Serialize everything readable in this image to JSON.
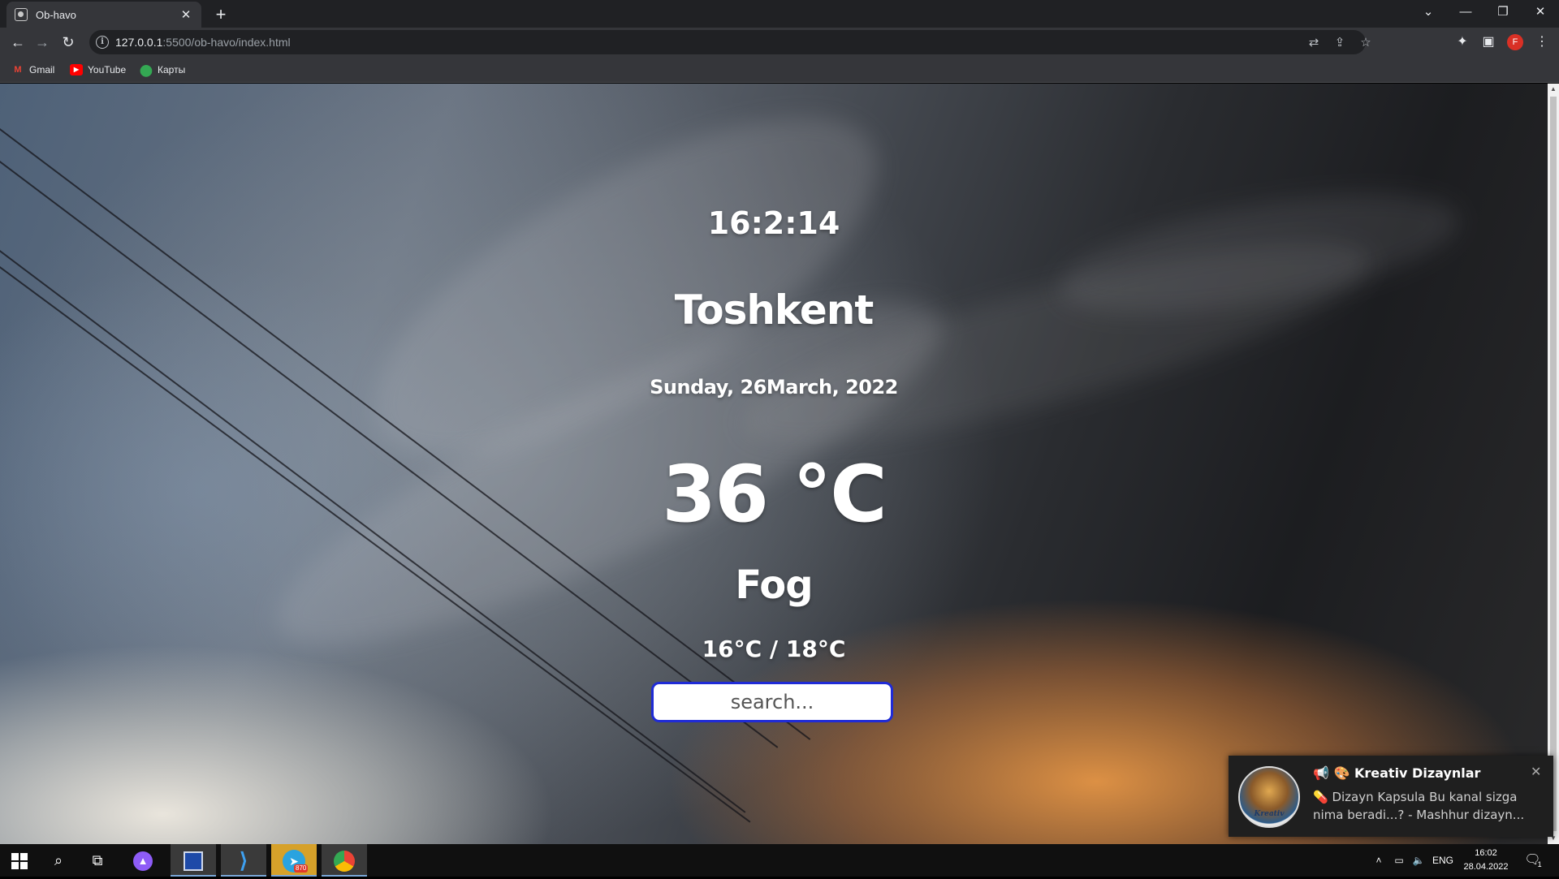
{
  "browser": {
    "tab_title": "Ob-havo",
    "url_host": "127.0.0.1",
    "url_rest": ":5500/ob-havo/index.html",
    "profile_initial": "F",
    "bookmarks": [
      {
        "label": "Gmail",
        "icon": "gmail-icon"
      },
      {
        "label": "YouTube",
        "icon": "youtube-icon"
      },
      {
        "label": "Карты",
        "icon": "maps-icon"
      }
    ]
  },
  "weather": {
    "time": "16:2:14",
    "city": "Toshkent",
    "date": "Sunday, 26March, 2022",
    "temperature": "36 °C",
    "condition": "Fog",
    "range": "16°C / 18°C",
    "search_placeholder": "search..."
  },
  "notification": {
    "title": "📢 🎨 Kreativ Dizaynlar",
    "text": "💊 Dizayn Kapsula  Bu kanal sizga nima beradi...?  - Mashhur dizayn...",
    "avatar_text": "Kreativ"
  },
  "taskbar": {
    "telegram_badge": "870",
    "tray_lang": "ENG",
    "clock_time": "16:02",
    "clock_date": "28.04.2022",
    "notif_count": "1"
  },
  "colors": {
    "search_border": "#1f2bd6",
    "chrome_dark": "#202124",
    "chrome_mid": "#35363a"
  }
}
